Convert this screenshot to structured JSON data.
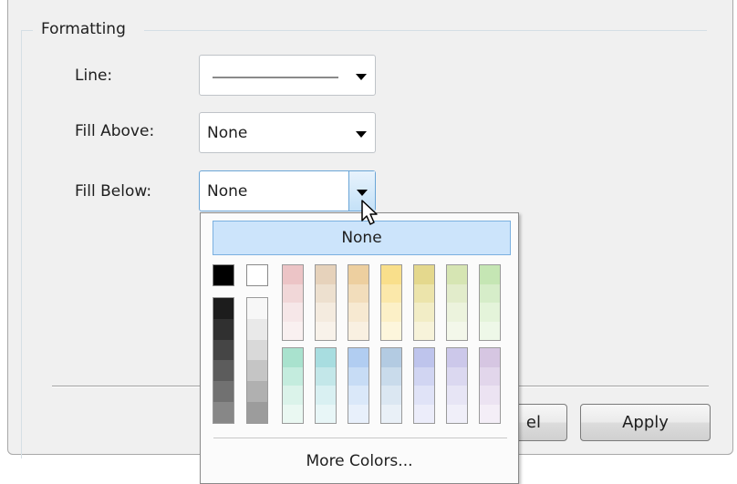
{
  "group": {
    "title": "Formatting"
  },
  "fields": {
    "line_label": "Line:",
    "fill_above_label": "Fill Above:",
    "fill_above_value": "None",
    "fill_below_label": "Fill Below:",
    "fill_below_value": "None"
  },
  "buttons": {
    "cancel_visible": "el",
    "apply": "Apply"
  },
  "popup": {
    "none_label": "None",
    "more_colors_label": "More Colors...",
    "top_swatches": [
      "#000000",
      "#ffffff"
    ],
    "grayscale_columns": [
      [
        "#1c1c1c",
        "#303030",
        "#454545",
        "#5c5c5c",
        "#717171",
        "#878787"
      ],
      [
        "#f7f7f7",
        "#e9e9e9",
        "#d9d9d9",
        "#c5c5c5",
        "#b0b0b0",
        "#9c9c9c"
      ]
    ],
    "color_columns_top": [
      [
        "#ecc4c6",
        "#f1d7d8",
        "#f6e7e8",
        "#f9f0f0"
      ],
      [
        "#e6d2bb",
        "#ede0cf",
        "#f4ebdf",
        "#f8f2ea"
      ],
      [
        "#edcf9f",
        "#f2ddbb",
        "#f7e9d1",
        "#f9f0e1"
      ],
      [
        "#f9df8b",
        "#fbe8aa",
        "#fcf0c7",
        "#fdf6dc"
      ],
      [
        "#e4d88d",
        "#ece4ab",
        "#f2edc6",
        "#f7f3da"
      ],
      [
        "#d6e5b3",
        "#e2eccb",
        "#ecf3dd",
        "#f3f7ea"
      ],
      [
        "#c5e6b4",
        "#d6edc9",
        "#e4f4da",
        "#eef8e8"
      ]
    ],
    "color_columns_bottom": [
      [
        "#a9e2ce",
        "#c4ecde",
        "#dbf3ea",
        "#eaf8f2"
      ],
      [
        "#a8dde0",
        "#c3e7e9",
        "#d9f0f2",
        "#e8f6f7"
      ],
      [
        "#b1cdf1",
        "#c7dcf5",
        "#dae8f9",
        "#e8f0fb"
      ],
      [
        "#b3cbe2",
        "#c9dbeb",
        "#dbe7f2",
        "#e9f0f7"
      ],
      [
        "#bec4ec",
        "#d1d5f2",
        "#e0e3f7",
        "#ecedfa"
      ],
      [
        "#ccc8ea",
        "#dbd8f0",
        "#e7e5f5",
        "#f0eff9"
      ],
      [
        "#d6c6e2",
        "#e2d6eb",
        "#ece3f2",
        "#f4eef7"
      ]
    ]
  }
}
